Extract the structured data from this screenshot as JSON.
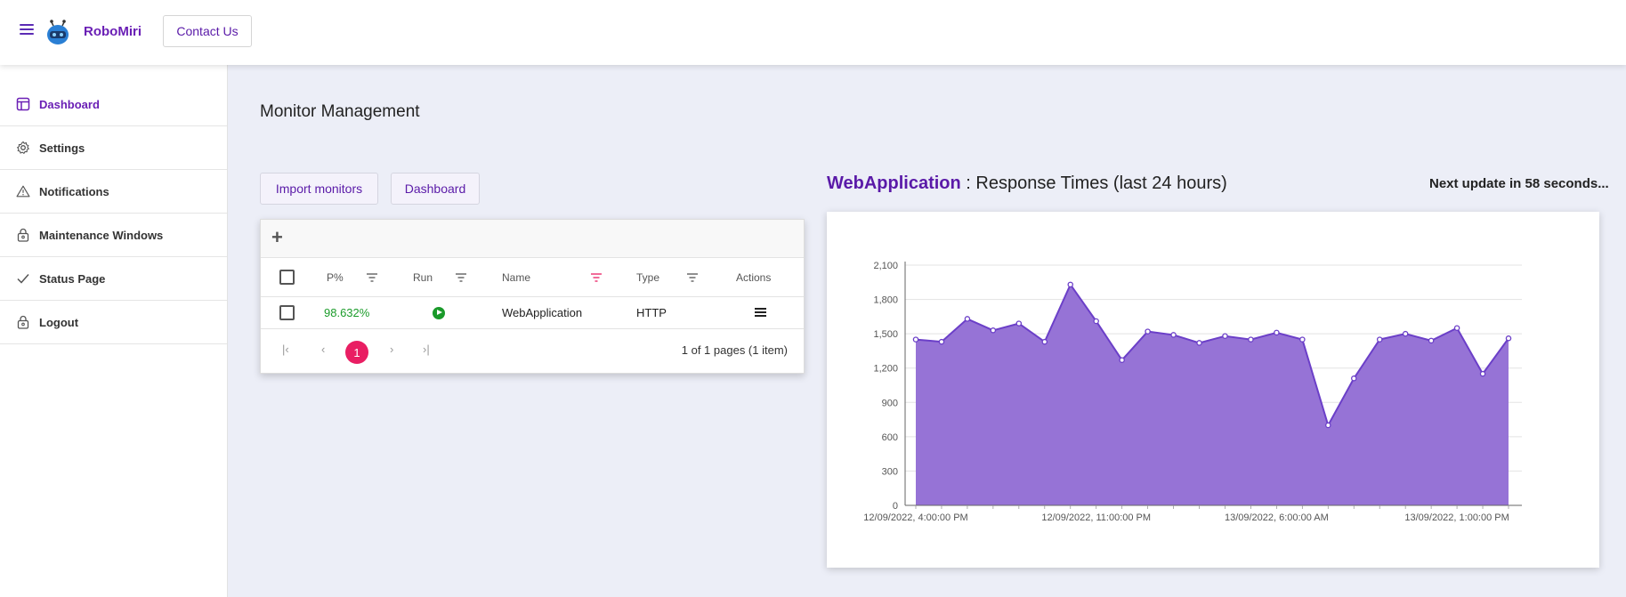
{
  "header": {
    "brand": "RoboMiri",
    "contact_label": "Contact Us"
  },
  "sidebar": {
    "items": [
      {
        "label": "Dashboard",
        "icon": "dashboard-icon",
        "active": true
      },
      {
        "label": "Settings",
        "icon": "gear-icon",
        "active": false
      },
      {
        "label": "Notifications",
        "icon": "warning-icon",
        "active": false
      },
      {
        "label": "Maintenance Windows",
        "icon": "lock-icon",
        "active": false
      },
      {
        "label": "Status Page",
        "icon": "check-icon",
        "active": false
      },
      {
        "label": "Logout",
        "icon": "lock-icon",
        "active": false
      }
    ]
  },
  "main": {
    "title": "Monitor Management",
    "import_label": "Import monitors",
    "dashboard_label": "Dashboard"
  },
  "grid": {
    "columns": [
      "P%",
      "Run",
      "Name",
      "Type",
      "Actions"
    ],
    "rows": [
      {
        "percent": "98.632%",
        "name": "WebApplication",
        "type": "HTTP"
      }
    ],
    "pager": {
      "current_page": "1",
      "info": "1 of 1 pages (1 item)"
    }
  },
  "chart_header": {
    "app_name": "WebApplication",
    "title_suffix": " : Response Times (last 24 hours)",
    "next_update": "Next update in 58 seconds..."
  },
  "colors": {
    "accent": "#6a1fb5",
    "chart_fill": "#9673d6",
    "chart_line": "#6b3fc8",
    "pager_active": "#e91e63",
    "status_green": "#1a9a2a"
  },
  "chart_data": {
    "type": "area",
    "title": "",
    "xlabel": "",
    "ylabel": "",
    "ylim": [
      0,
      2100
    ],
    "yticks": [
      0,
      300,
      600,
      900,
      1200,
      1500,
      1800,
      2100
    ],
    "ytick_labels": [
      "0",
      "300",
      "600",
      "900",
      "1,200",
      "1,500",
      "1,800",
      "2,100"
    ],
    "xtick_labels": [
      "12/09/2022, 4:00:00 PM",
      "12/09/2022, 11:00:00 PM",
      "13/09/2022, 6:00:00 AM",
      "13/09/2022, 1:00:00 PM"
    ],
    "xtick_index": [
      0,
      7,
      14,
      21
    ],
    "grid": true,
    "series": [
      {
        "values": [
          1450,
          1430,
          1630,
          1530,
          1590,
          1430,
          1930,
          1610,
          1270,
          1520,
          1490,
          1420,
          1480,
          1450,
          1510,
          1450,
          700,
          1110,
          1450,
          1500,
          1440,
          1550,
          1150,
          1460
        ]
      }
    ]
  }
}
